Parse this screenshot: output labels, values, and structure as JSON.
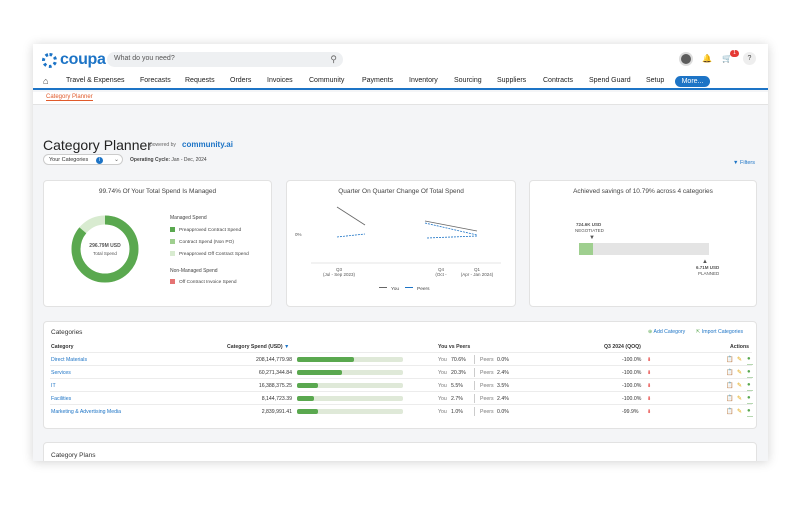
{
  "app": {
    "logo_text": "coupa",
    "search_placeholder": "What do you need?",
    "cart_badge": "1",
    "help_label": "?"
  },
  "nav": {
    "items": [
      "Travel & Expenses",
      "Forecasts",
      "Requests",
      "Orders",
      "Invoices",
      "Community",
      "Payments",
      "Inventory",
      "Sourcing",
      "Suppliers",
      "Contracts",
      "Spend Guard",
      "Setup"
    ],
    "more_label": "More...",
    "breadcrumb": "Category Planner"
  },
  "page": {
    "title": "Category Planner",
    "powered_by": "powered by",
    "brand": "community.ai",
    "your_categories": "Your Categories",
    "operating_cycle_label": "Operating Cycle:",
    "operating_cycle_value": "Jan - Dec, 2024",
    "filters_label": "Filters"
  },
  "cards": {
    "managed": {
      "title": "99.74% Of Your Total Spend Is Managed",
      "center_value": "296.79M USD",
      "center_label": "Total Spend",
      "managed_heading": "Managed Spend",
      "managed_items": [
        "Preapproved Contract Spend",
        "Contract Spend (Non PO)",
        "Preapproved Off Contract Spend"
      ],
      "non_managed_heading": "Non-Managed Spend",
      "non_managed_items": [
        "Off Contract Invoice Spend"
      ],
      "colors": [
        "#5aa84f",
        "#9fcf8f",
        "#d8ebd0",
        "#e57373"
      ]
    },
    "qoq": {
      "title": "Quarter On Quarter Change Of Total Spend",
      "y_label": "0%",
      "x_labels": [
        {
          "quarter": "Q3",
          "range": "(Jul - Sep 2023)"
        },
        {
          "quarter": "Q4",
          "range": "(Oct -"
        },
        {
          "quarter": "Q1",
          "range": "(Apr - Jan 2024)"
        }
      ],
      "legend_you": "You",
      "legend_peers": "Peers"
    },
    "savings": {
      "title": "Achieved savings of 10.79% across 4 categories",
      "negotiated_value": "724.6K USD",
      "negotiated_label": "NEGOTIATED",
      "planned_value": "6.71M USD",
      "planned_label": "PLANNED",
      "negotiated_fraction": 0.108
    }
  },
  "categories": {
    "title": "Categories",
    "add_label": "Add Category",
    "import_label": "Import Categories",
    "headers": {
      "category": "Category",
      "spend": "Category Spend (USD)",
      "peers": "You vs Peers",
      "qoq": "Q3 2024 (QOQ)",
      "actions": "Actions"
    },
    "you_label": "You",
    "peers_label": "Peers",
    "rows": [
      {
        "name": "Direct Materials",
        "spend": "208,144,779.98",
        "spend_fraction": 0.54,
        "you": "70.6%",
        "peers": "0.0%",
        "qoq": "-100.0%"
      },
      {
        "name": "Services",
        "spend": "60,271,344.84",
        "spend_fraction": 0.42,
        "you": "20.3%",
        "peers": "2.4%",
        "qoq": "-100.0%"
      },
      {
        "name": "IT",
        "spend": "16,388,375.25",
        "spend_fraction": 0.2,
        "you": "5.5%",
        "peers": "3.5%",
        "qoq": "-100.0%"
      },
      {
        "name": "Facilities",
        "spend": "8,144,723.39",
        "spend_fraction": 0.16,
        "you": "2.7%",
        "peers": "2.4%",
        "qoq": "-100.0%"
      },
      {
        "name": "Marketing & Advertising Media",
        "spend": "2,839,991.41",
        "spend_fraction": 0.2,
        "you": "1.0%",
        "peers": "0.0%",
        "qoq": "-99.9%"
      }
    ]
  },
  "plans": {
    "title": "Category Plans"
  }
}
